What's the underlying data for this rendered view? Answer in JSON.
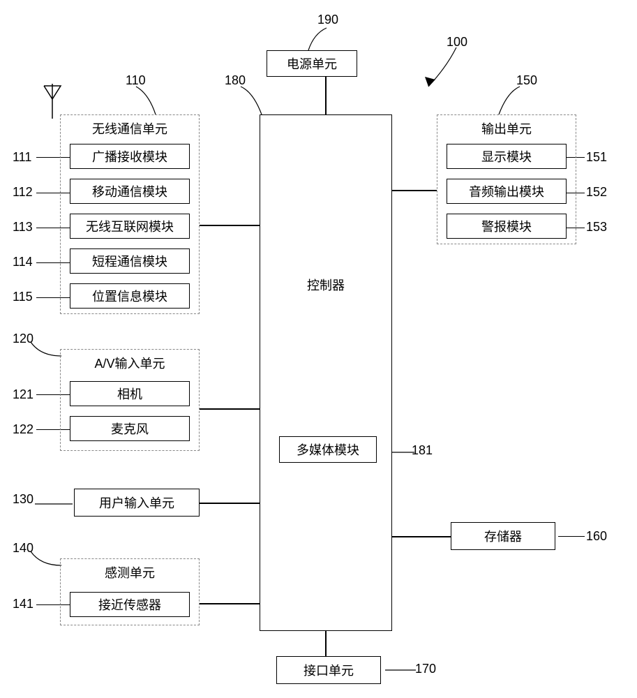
{
  "refs": {
    "r100": "100",
    "r190": "190",
    "r180": "180",
    "r110": "110",
    "r111": "111",
    "r112": "112",
    "r113": "113",
    "r114": "114",
    "r115": "115",
    "r120": "120",
    "r121": "121",
    "r122": "122",
    "r130": "130",
    "r140": "140",
    "r141": "141",
    "r150": "150",
    "r151": "151",
    "r152": "152",
    "r153": "153",
    "r160": "160",
    "r170": "170",
    "r181": "181"
  },
  "blocks": {
    "power": "电源单元",
    "controller": "控制器",
    "multimedia": "多媒体模块",
    "wireless_unit": "无线通信单元",
    "broadcast": "广播接收模块",
    "mobile_comm": "移动通信模块",
    "wireless_net": "无线互联网模块",
    "short_range": "短程通信模块",
    "location": "位置信息模块",
    "av_input": "A/V输入单元",
    "camera": "相机",
    "mic": "麦克风",
    "user_input": "用户输入单元",
    "sensing_unit": "感测单元",
    "proximity": "接近传感器",
    "output_unit": "输出单元",
    "display": "显示模块",
    "audio_out": "音频输出模块",
    "alarm": "警报模块",
    "memory": "存储器",
    "interface": "接口单元"
  }
}
